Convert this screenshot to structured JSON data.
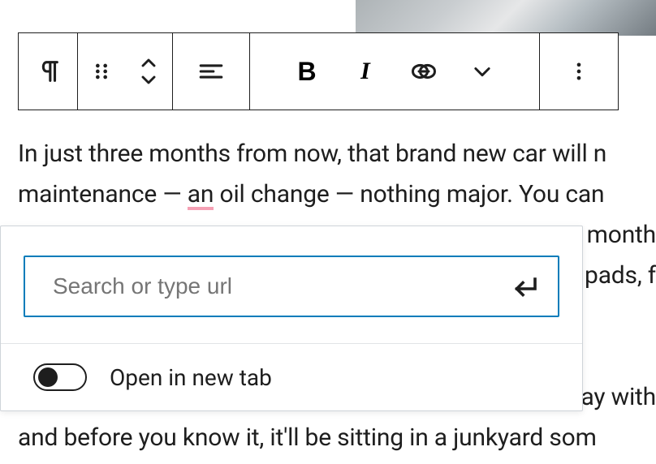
{
  "content": {
    "line1_pre": "In just three months from now, that brand new car will n",
    "line2_pre": "maintenance — ",
    "underlined": "an",
    "line2_post": " oil change — nothing major. You can",
    "line3_tail": "month",
    "line4_tail": "pads, f",
    "line5_tail": "ay with",
    "line6": "and before you know it, it'll be sitting in a junkyard som"
  },
  "link_popover": {
    "placeholder": "Search or type url",
    "value": "",
    "open_new_tab_label": "Open in new tab"
  },
  "toolbar": {
    "paragraph": "paragraph",
    "drag": "drag-handle",
    "move": "move-up-down",
    "align": "align",
    "bold": "B",
    "italic": "I",
    "link": "link",
    "more_inline": "more-inline",
    "more_options": "more-options"
  }
}
